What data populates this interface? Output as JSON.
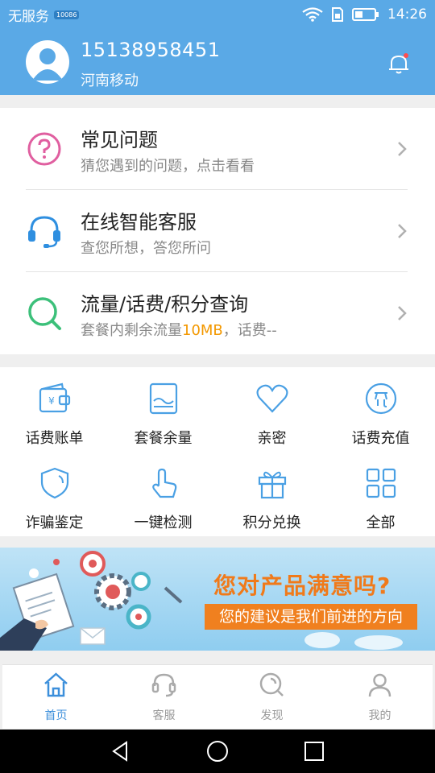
{
  "status_bar": {
    "carrier_text": "无服务",
    "sim_chip": "10086",
    "time": "14:26"
  },
  "header": {
    "phone": "15138958451",
    "carrier": "河南移动"
  },
  "list": [
    {
      "title": "常见问题",
      "subtitle": "猜您遇到的问题，点击看看"
    },
    {
      "title": "在线智能客服",
      "subtitle": "查您所想，答您所问"
    },
    {
      "title": "流量/话费/积分查询",
      "subtitle_prefix": "套餐内剩余流量",
      "subtitle_highlight": "10MB",
      "subtitle_suffix": "，话费--"
    }
  ],
  "grid": [
    {
      "label": "话费账单",
      "icon": "wallet-icon"
    },
    {
      "label": "套餐余量",
      "icon": "package-icon"
    },
    {
      "label": "亲密",
      "icon": "heart-icon"
    },
    {
      "label": "话费充值",
      "icon": "recharge-icon"
    },
    {
      "label": "诈骗鉴定",
      "icon": "shield-icon"
    },
    {
      "label": "一键检测",
      "icon": "tap-icon"
    },
    {
      "label": "积分兑换",
      "icon": "gift-icon"
    },
    {
      "label": "全部",
      "icon": "grid-icon"
    }
  ],
  "banner": {
    "headline": "您对产品满意吗?",
    "subline": "您的建议是我们前进的方向"
  },
  "tabs": [
    {
      "label": "首页",
      "icon": "home-icon",
      "active": true
    },
    {
      "label": "客服",
      "icon": "headset-icon",
      "active": false
    },
    {
      "label": "发现",
      "icon": "discover-icon",
      "active": false
    },
    {
      "label": "我的",
      "icon": "profile-icon",
      "active": false
    }
  ],
  "colors": {
    "brand_blue": "#5aa9e6",
    "tab_active": "#3c8fdb",
    "highlight_orange": "#f39800",
    "banner_orange": "#f07a1a"
  }
}
